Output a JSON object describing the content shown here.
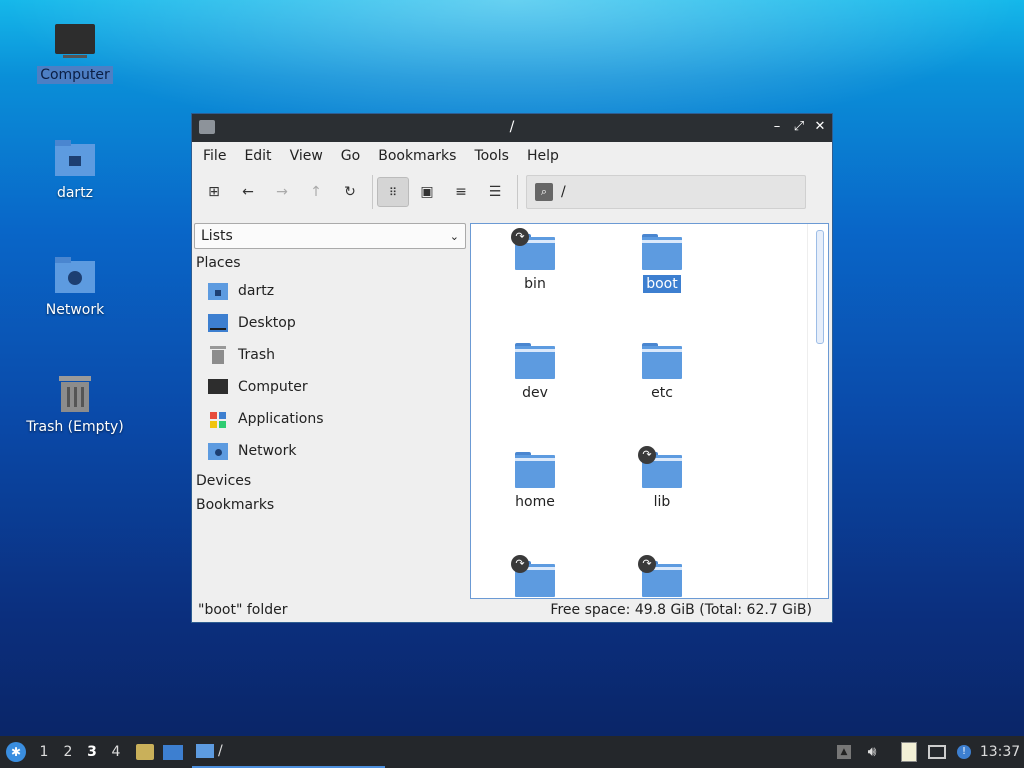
{
  "desktop": {
    "icons": [
      {
        "label": "Computer",
        "icon": "computer-icon"
      },
      {
        "label": "dartz",
        "icon": "home-folder-icon"
      },
      {
        "label": "Network",
        "icon": "network-folder-icon"
      },
      {
        "label": "Trash (Empty)",
        "icon": "trash-icon"
      }
    ]
  },
  "window": {
    "title": "/",
    "menu": [
      "File",
      "Edit",
      "View",
      "Go",
      "Bookmarks",
      "Tools",
      "Help"
    ],
    "toolbar": {
      "buttons": [
        "new-tab-icon",
        "back-arrow-icon",
        "forward-arrow-icon",
        "up-arrow-icon",
        "reload-icon",
        "icon-view-icon",
        "thumbnail-view-icon",
        "compact-view-icon",
        "detailed-list-icon"
      ],
      "path": "/"
    },
    "sidebar": {
      "combo": "Lists",
      "places_label": "Places",
      "places": [
        {
          "label": "dartz",
          "icon": "home-folder-icon"
        },
        {
          "label": "Desktop",
          "icon": "desktop-icon"
        },
        {
          "label": "Trash",
          "icon": "trash-icon"
        },
        {
          "label": "Computer",
          "icon": "computer-icon"
        },
        {
          "label": "Applications",
          "icon": "applications-icon"
        },
        {
          "label": "Network",
          "icon": "network-folder-icon"
        }
      ],
      "devices_label": "Devices",
      "bookmarks_label": "Bookmarks"
    },
    "files": [
      {
        "name": "bin",
        "link": true,
        "selected": false
      },
      {
        "name": "boot",
        "link": false,
        "selected": true
      },
      {
        "name": "dev",
        "link": false,
        "selected": false
      },
      {
        "name": "etc",
        "link": false,
        "selected": false
      },
      {
        "name": "home",
        "link": false,
        "selected": false
      },
      {
        "name": "lib",
        "link": true,
        "selected": false
      },
      {
        "name": "",
        "link": true,
        "selected": false
      },
      {
        "name": "",
        "link": true,
        "selected": false
      }
    ],
    "status": {
      "left": "\"boot\" folder",
      "right": "Free space: 49.8 GiB (Total: 62.7 GiB)"
    }
  },
  "taskbar": {
    "workspaces": [
      "1",
      "2",
      "3",
      "4"
    ],
    "current_workspace": "3",
    "task_title": "/",
    "clock": "13:37"
  }
}
